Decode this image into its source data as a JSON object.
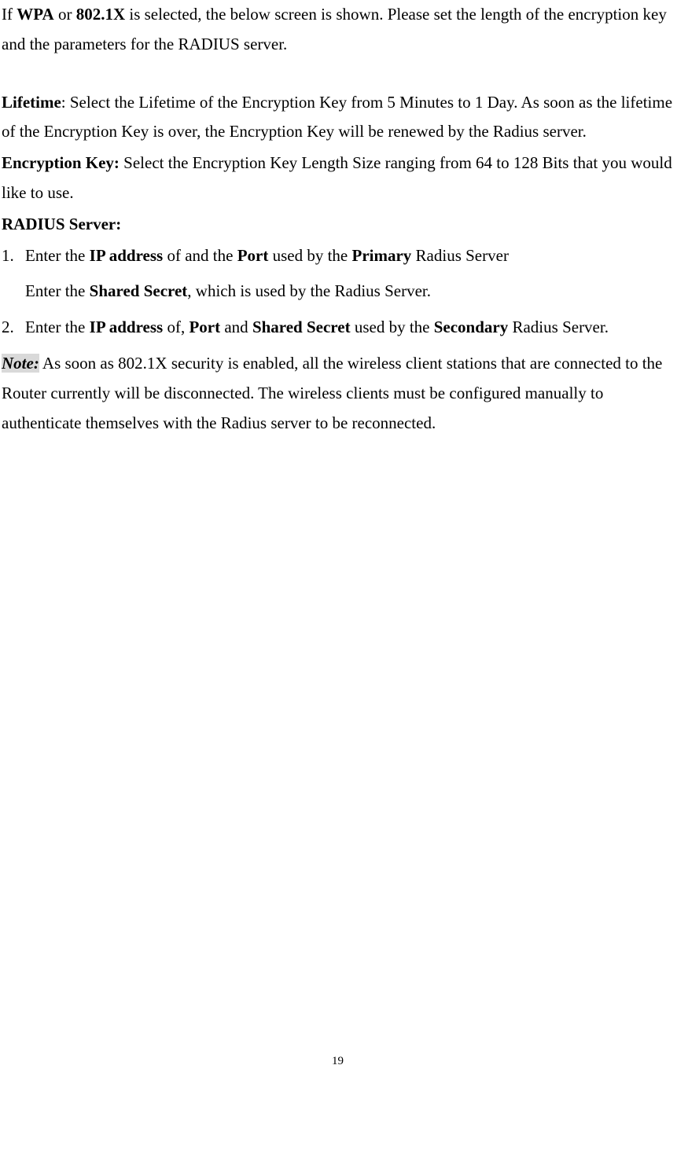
{
  "intro": {
    "pre1": "If ",
    "b1": "WPA",
    "mid1": " or ",
    "b2": "802.1X",
    "post1": " is selected, the below screen is shown.    Please set the length of the encryption key and the parameters for the RADIUS server."
  },
  "lifetime": {
    "label": "Lifetime",
    "text": ": Select the Lifetime of the Encryption Key from 5 Minutes to 1 Day.    As soon as the lifetime of the Encryption Key is over, the Encryption Key will be renewed by the Radius server."
  },
  "encryptionKey": {
    "label": "Encryption Key:",
    "text": " Select the Encryption Key Length Size ranging from 64 to 128 Bits that you would like to use."
  },
  "radiusServer": {
    "label": "RADIUS Server:"
  },
  "item1": {
    "num": "1.",
    "pre1": "Enter the ",
    "b1": "IP address",
    "mid1": " of and the ",
    "b2": "Port",
    "mid2": " used by the ",
    "b3": "Primary",
    "post1": " Radius Server",
    "line2pre": "Enter the ",
    "line2b": "Shared Secret",
    "line2post": ", which is used by the Radius Server."
  },
  "item2": {
    "num": "2.",
    "pre1": "Enter the ",
    "b1": "IP address",
    "mid1": " of, ",
    "b2": "Port",
    "mid2": " and ",
    "b3": "Shared Secret",
    "mid3": " used by the ",
    "b4": "Secondary",
    "post1": " Radius Server."
  },
  "note": {
    "label": "Note:",
    "text": " As soon as 802.1X security is enabled, all the wireless client stations that are connected to the Router currently will be disconnected.    The wireless clients must be configured manually to authenticate themselves with the Radius server to be reconnected."
  },
  "pageNumber": "19"
}
